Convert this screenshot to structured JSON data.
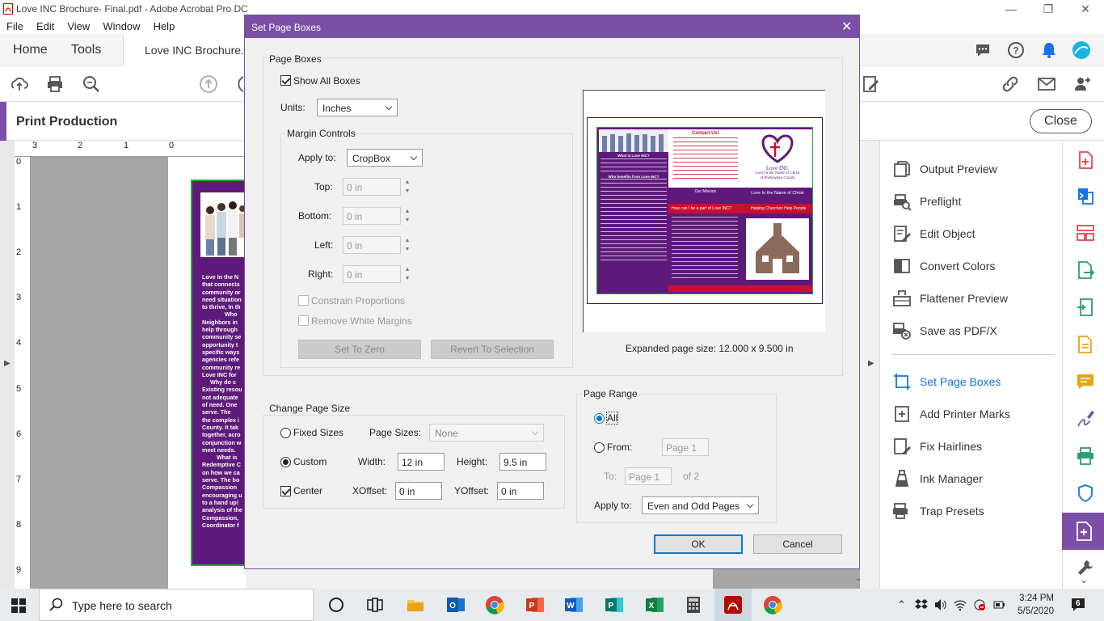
{
  "window": {
    "title": "Love INC Brochure- Final.pdf - Adobe Acrobat Pro DC"
  },
  "menu": [
    "File",
    "Edit",
    "View",
    "Window",
    "Help"
  ],
  "tabs": {
    "home": "Home",
    "tools": "Tools",
    "document": "Love INC Brochure..."
  },
  "print_production": {
    "title": "Print Production",
    "close": "Close"
  },
  "ruler": {
    "top": [
      "3",
      "2",
      "1",
      "0"
    ],
    "left": [
      "0",
      "1",
      "2",
      "3",
      "4",
      "5",
      "6",
      "7",
      "8",
      "9"
    ]
  },
  "doc_text": [
    "Love In the N",
    "that connects",
    "community or",
    "need situation",
    "to thrive, In th",
    "Who",
    "Neighbors in",
    "help through",
    "community se",
    "opportunity t",
    "specific ways",
    "agencies refe",
    "community re",
    "Love INC for",
    "Why do c",
    "Existing resou",
    "not adequate",
    "of need. One",
    "serve. The",
    "the complex i",
    "County. It tak",
    "together, acro",
    "conjunction w",
    "meet needs.",
    "What is",
    "Redemptive C",
    "on how we ca",
    "serve. The bo",
    "Compassion",
    "encouraging u",
    "to a hand up!",
    "analysis of the",
    "Compassion,",
    "Coordinator f"
  ],
  "tools": [
    {
      "name": "output-preview",
      "label": "Output Preview",
      "icon": "output-preview-icon"
    },
    {
      "name": "preflight",
      "label": "Preflight",
      "icon": "preflight-icon"
    },
    {
      "name": "edit-object",
      "label": "Edit Object",
      "icon": "edit-object-icon"
    },
    {
      "name": "convert-colors",
      "label": "Convert Colors",
      "icon": "convert-colors-icon"
    },
    {
      "name": "flattener-preview",
      "label": "Flattener Preview",
      "icon": "flattener-preview-icon"
    },
    {
      "name": "save-as-pdfx",
      "label": "Save as PDF/X",
      "icon": "save-pdfx-icon"
    },
    {
      "name": "set-page-boxes",
      "label": "Set Page Boxes",
      "icon": "set-page-boxes-icon"
    },
    {
      "name": "add-printer-marks",
      "label": "Add Printer Marks",
      "icon": "add-printer-marks-icon"
    },
    {
      "name": "fix-hairlines",
      "label": "Fix Hairlines",
      "icon": "fix-hairlines-icon"
    },
    {
      "name": "ink-manager",
      "label": "Ink Manager",
      "icon": "ink-manager-icon"
    },
    {
      "name": "trap-presets",
      "label": "Trap Presets",
      "icon": "trap-presets-icon"
    }
  ],
  "dialog": {
    "title": "Set Page Boxes",
    "page_boxes": {
      "label": "Page Boxes",
      "show_all_boxes": "Show All Boxes",
      "units_label": "Units:",
      "units_value": "Inches"
    },
    "margin_controls": {
      "label": "Margin Controls",
      "apply_to_label": "Apply to:",
      "apply_to_value": "CropBox",
      "top_label": "Top:",
      "top_value": "0 in",
      "bottom_label": "Bottom:",
      "bottom_value": "0 in",
      "left_label": "Left:",
      "left_value": "0 in",
      "right_label": "Right:",
      "right_value": "0 in",
      "constrain": "Constrain Proportions",
      "remove_white": "Remove White Margins",
      "set_to_zero": "Set To Zero",
      "revert": "Revert To Selection"
    },
    "preview": {
      "expanded_size": "Expanded page size: 12.000 x 9.500 in",
      "contact_title": "Contact Us!",
      "logo_name": "Love INC",
      "logo_tag": "Love In the Name of Christ",
      "logo_sub": "of Sheboygan County",
      "mission_title": "Our Mission",
      "banner1": "Love In the Name of Christ",
      "banner2": "How can I be a part of Love INC?",
      "banner3": "Helping Churches Help People",
      "what_is": "What is Love INC?",
      "who_benefits": "Who benefits from Love INC?"
    },
    "change_page_size": {
      "label": "Change Page Size",
      "fixed_sizes": "Fixed Sizes",
      "page_sizes_label": "Page Sizes:",
      "page_sizes_value": "None",
      "custom": "Custom",
      "width_label": "Width:",
      "width_value": "12 in",
      "height_label": "Height:",
      "height_value": "9.5 in",
      "center": "Center",
      "xoffset_label": "XOffset:",
      "xoffset_value": "0 in",
      "yoffset_label": "YOffset:",
      "yoffset_value": "0 in"
    },
    "page_range": {
      "label": "Page Range",
      "all": "All",
      "from": "From:",
      "from_value": "Page 1",
      "to": "To:",
      "to_value": "Page 1",
      "of": "of 2",
      "apply_to_label": "Apply to:",
      "apply_to_value": "Even and Odd Pages"
    },
    "ok": "OK",
    "cancel": "Cancel"
  },
  "taskbar": {
    "search_placeholder": "Type here to search",
    "time": "3:24 PM",
    "date": "5/5/2020",
    "notifications": "6"
  },
  "colors": {
    "accent": "#7b4fa6",
    "doc_purple": "#5e1a7a",
    "crimson": "#c8102e",
    "blue": "#0078d7"
  }
}
